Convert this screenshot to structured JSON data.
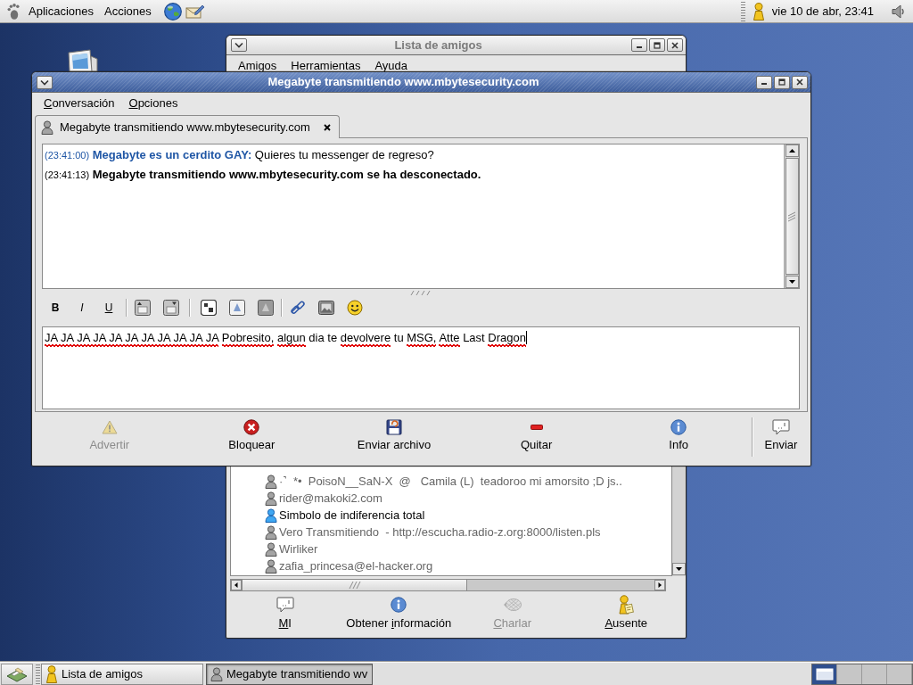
{
  "top_panel": {
    "menus": [
      "Aplicaciones",
      "Acciones"
    ],
    "clock": "vie 10 de abr, 23:41"
  },
  "buddy_window": {
    "title": "Lista de amigos",
    "active": false,
    "menus": [
      "Amigos",
      "Herramientas",
      "Ayuda"
    ],
    "buddies": [
      {
        "name": "·˺  *•  PoisoN__SaN-X  @   Camila (L)  teadoroo mi amorsito ;D js..",
        "idle": true
      },
      {
        "name": "rider@makoki2.com",
        "idle": true
      },
      {
        "name": "Simbolo de indiferencia total",
        "idle": false
      },
      {
        "name": "Vero Transmitiendo  - http://escucha.radio-z.org:8000/listen.pls",
        "idle": true
      },
      {
        "name": "Wirliker",
        "idle": true
      },
      {
        "name": "zafia_princesa@el-hacker.org",
        "idle": true
      }
    ],
    "buttons": [
      {
        "label": "MI",
        "kind": "message",
        "disabled": false,
        "mnemonic": true
      },
      {
        "label": "Obtener información",
        "kind": "info",
        "disabled": false,
        "mnemonic": true,
        "mnemonic_last_word": true
      },
      {
        "label": "Charlar",
        "kind": "chat",
        "disabled": true,
        "mnemonic": true
      },
      {
        "label": "Ausente",
        "kind": "away",
        "disabled": false,
        "mnemonic": true
      }
    ]
  },
  "chat_window": {
    "title": "Megabyte transmitiendo www.mbytesecurity.com",
    "active": true,
    "menus": [
      {
        "label": "Conversación",
        "mnemonic": true
      },
      {
        "label": "Opciones",
        "mnemonic": true
      }
    ],
    "tabs": [
      {
        "label": "Megabyte transmitiendo www.mbytesecurity.com",
        "selected": true
      }
    ],
    "messages": [
      {
        "kind": "received",
        "time": "(23:41:00)",
        "sender": "Megabyte es un cerdito GAY:",
        "text": "Quieres tu messenger de regreso?"
      },
      {
        "kind": "system",
        "time": "(23:41:13)",
        "text": "Megabyte transmitiendo www.mbytesecurity.com se ha desconectado."
      }
    ],
    "format_buttons": [
      {
        "kind": "bold",
        "label": "B"
      },
      {
        "kind": "italic",
        "label": "I"
      },
      {
        "kind": "underline",
        "label": "U"
      }
    ],
    "message_input": {
      "segments": [
        {
          "text": "JA JA JA JA JA JA JA JA JA JA JA",
          "misspelled": true
        },
        {
          "text": "Pobresito,",
          "misspelled": true
        },
        {
          "text": "algun",
          "misspelled": true
        },
        {
          "text": "dia te",
          "misspelled": false
        },
        {
          "text": "devolvere",
          "misspelled": true
        },
        {
          "text": "tu",
          "misspelled": false
        },
        {
          "text": "MSG,",
          "misspelled": true
        },
        {
          "text": "Atte",
          "misspelled": true
        },
        {
          "text": "Last",
          "misspelled": false
        },
        {
          "text": "Dragon",
          "misspelled": true
        }
      ]
    },
    "buttons": [
      {
        "label": "Advertir",
        "kind": "warn",
        "disabled": true
      },
      {
        "label": "Bloquear",
        "kind": "block",
        "disabled": false
      },
      {
        "label": "Enviar archivo",
        "kind": "file",
        "disabled": false
      },
      {
        "label": "Quitar",
        "kind": "remove",
        "disabled": false
      },
      {
        "label": "Info",
        "kind": "info",
        "disabled": false
      },
      {
        "label": "Enviar",
        "kind": "send",
        "disabled": false
      }
    ]
  },
  "taskbar": {
    "tasks": [
      {
        "label": "Lista de amigos",
        "kind": "buddy_list",
        "selected": false
      },
      {
        "label": "Megabyte transmitiendo wv",
        "kind": "conversation",
        "selected": true
      }
    ],
    "workspaces": [
      {
        "selected": true
      },
      {
        "selected": false
      },
      {
        "selected": false
      },
      {
        "selected": false
      }
    ]
  }
}
